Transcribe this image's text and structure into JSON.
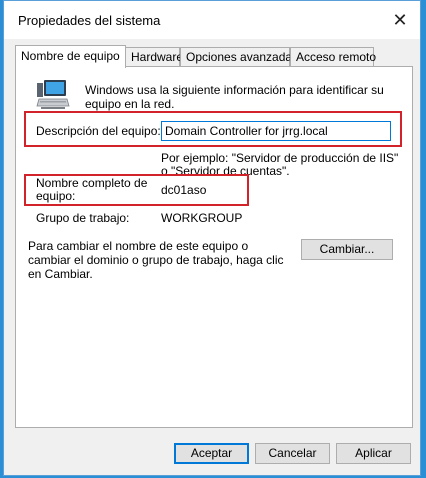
{
  "window": {
    "title": "Propiedades del sistema"
  },
  "tabs": [
    {
      "label": "Nombre de equipo",
      "active": true
    },
    {
      "label": "Hardware"
    },
    {
      "label": "Opciones avanzadas"
    },
    {
      "label": "Acceso remoto"
    }
  ],
  "panel": {
    "info_text": "Windows usa la siguiente información para identificar su equipo en la red.",
    "description_label": "Descripción del equipo:",
    "description_value": "Domain Controller for jrrg.local",
    "example_text": "Por ejemplo: \"Servidor de producción de IIS\" o \"Servidor de cuentas\".",
    "full_name_label": "Nombre completo de equipo:",
    "full_name_value": "dc01aso",
    "workgroup_label": "Grupo de trabajo:",
    "workgroup_value": "WORKGROUP",
    "change_text": "Para cambiar el nombre de este equipo o cambiar el dominio o grupo de trabajo, haga clic en Cambiar.",
    "change_button": "Cambiar..."
  },
  "buttons": {
    "ok": "Aceptar",
    "cancel": "Cancelar",
    "apply": "Aplicar"
  },
  "colors": {
    "highlight": "#d2232a",
    "focus": "#0078d7",
    "desktop": "#2b8fd6"
  },
  "icons": {
    "computer": "computer-icon",
    "close": "close-icon"
  }
}
